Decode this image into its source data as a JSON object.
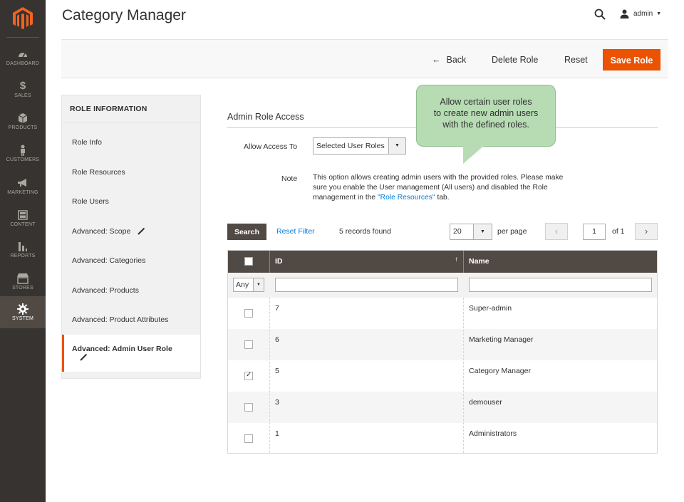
{
  "header": {
    "page_title": "Category Manager",
    "user_name": "admin"
  },
  "nav": {
    "items": [
      {
        "label": "DASHBOARD",
        "icon": "dashboard-icon"
      },
      {
        "label": "SALES",
        "icon": "dollar-icon"
      },
      {
        "label": "PRODUCTS",
        "icon": "cube-icon"
      },
      {
        "label": "CUSTOMERS",
        "icon": "person-icon"
      },
      {
        "label": "MARKETING",
        "icon": "megaphone-icon"
      },
      {
        "label": "CONTENT",
        "icon": "layout-icon"
      },
      {
        "label": "REPORTS",
        "icon": "bar-chart-icon"
      },
      {
        "label": "STORES",
        "icon": "storefront-icon"
      },
      {
        "label": "SYSTEM",
        "icon": "gear-icon",
        "active": true
      }
    ]
  },
  "actions": {
    "back": "Back",
    "delete": "Delete Role",
    "reset": "Reset",
    "save": "Save Role"
  },
  "tabs": {
    "title": "ROLE INFORMATION",
    "items": [
      "Role Info",
      "Role Resources",
      "Role Users",
      "Advanced: Scope",
      "Advanced: Categories",
      "Advanced: Products",
      "Advanced: Product Attributes",
      "Advanced: Admin User Role"
    ]
  },
  "section": {
    "title": "Admin Role Access",
    "allow_label": "Allow Access To",
    "allow_value": "Selected User Roles",
    "note_label": "Note",
    "note_text": "This option allows creating admin users with the provided roles. Please make sure you enable the User management (All users) and disabled the Role management in the ",
    "note_link": "\"Role Resources\"",
    "note_suffix": " tab."
  },
  "tooltip": {
    "text_1": "Allow certain user roles",
    "text_2": "to create new admin users",
    "text_3": "with the defined roles."
  },
  "grid_toolbar": {
    "search": "Search",
    "reset_filter": "Reset Filter",
    "records": "5 records found",
    "per_page_value": "20",
    "per_page_label": "per page",
    "page": "1",
    "of_pages": "of 1"
  },
  "grid": {
    "col_id": "ID",
    "col_name": "Name",
    "filter_any": "Any",
    "rows": [
      {
        "id": "7",
        "name": "Super-admin",
        "checked": false
      },
      {
        "id": "6",
        "name": "Marketing Manager",
        "checked": false
      },
      {
        "id": "5",
        "name": "Category Manager",
        "checked": true
      },
      {
        "id": "3",
        "name": "demouser",
        "checked": false
      },
      {
        "id": "1",
        "name": "Administrators",
        "checked": false
      }
    ]
  },
  "colors": {
    "accent": "#eb5202",
    "nav_bg": "#373330",
    "grid_head": "#514943",
    "link": "#007bdb",
    "tooltip": "#b7dcb4"
  }
}
